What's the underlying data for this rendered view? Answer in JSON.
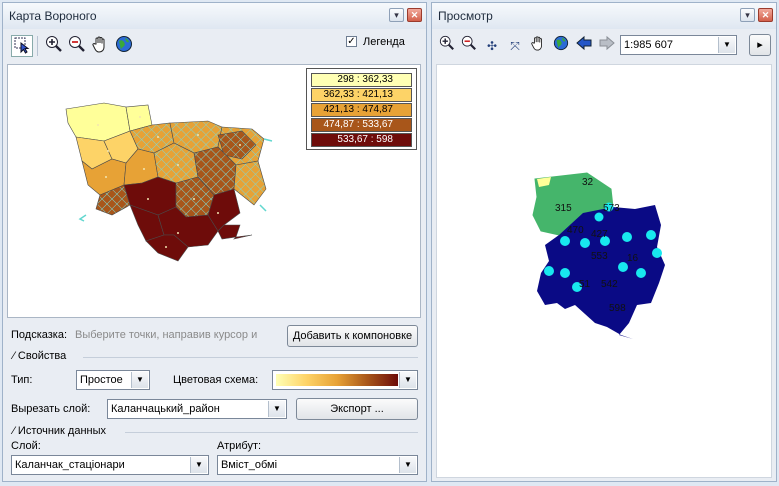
{
  "voronoi": {
    "title": "Карта Вороного",
    "legend_label": "Легенда",
    "legend_checked": true,
    "legend": [
      {
        "label": "298 : 362,33",
        "color": "#ffffb4"
      },
      {
        "label": "362,33 : 421,13",
        "color": "#fdd367"
      },
      {
        "label": "421,13 : 474,87",
        "color": "#e7a236"
      },
      {
        "label": "474,87 : 533,67",
        "color": "#a8561a"
      },
      {
        "label": "533,67 : 598",
        "color": "#6e0c0a"
      }
    ],
    "hint_label": "Подсказка:",
    "hint_text": "Выберите точки, направив курсор и",
    "add_to_layout": "Добавить к компоновке",
    "properties_label": "Свойства",
    "type_label": "Тип:",
    "type_value": "Простое",
    "color_scheme_label": "Цветовая схема:",
    "cut_layer_label": "Вырезать слой:",
    "cut_layer_value": "Каланчацький_район",
    "export_label": "Экспорт ...",
    "data_source_label": "Источник данных",
    "layer_label": "Слой:",
    "layer_value": "Каланчак_стаціонари",
    "attribute_label": "Атрибут:",
    "attribute_value": "Вміст_обмі"
  },
  "preview": {
    "title": "Просмотр",
    "scale_value": "1:985 607",
    "map_labels": [
      "315",
      "32",
      "573",
      "470",
      "427",
      "553",
      "16",
      "542",
      "51",
      "598"
    ]
  },
  "icons": {
    "select": "select-arrow-icon",
    "zoom_in": "zoom-in-icon",
    "zoom_out": "zoom-out-icon",
    "pan": "pan-hand-icon",
    "globe": "globe-icon",
    "back": "back-arrow-icon",
    "forward": "forward-arrow-icon"
  }
}
